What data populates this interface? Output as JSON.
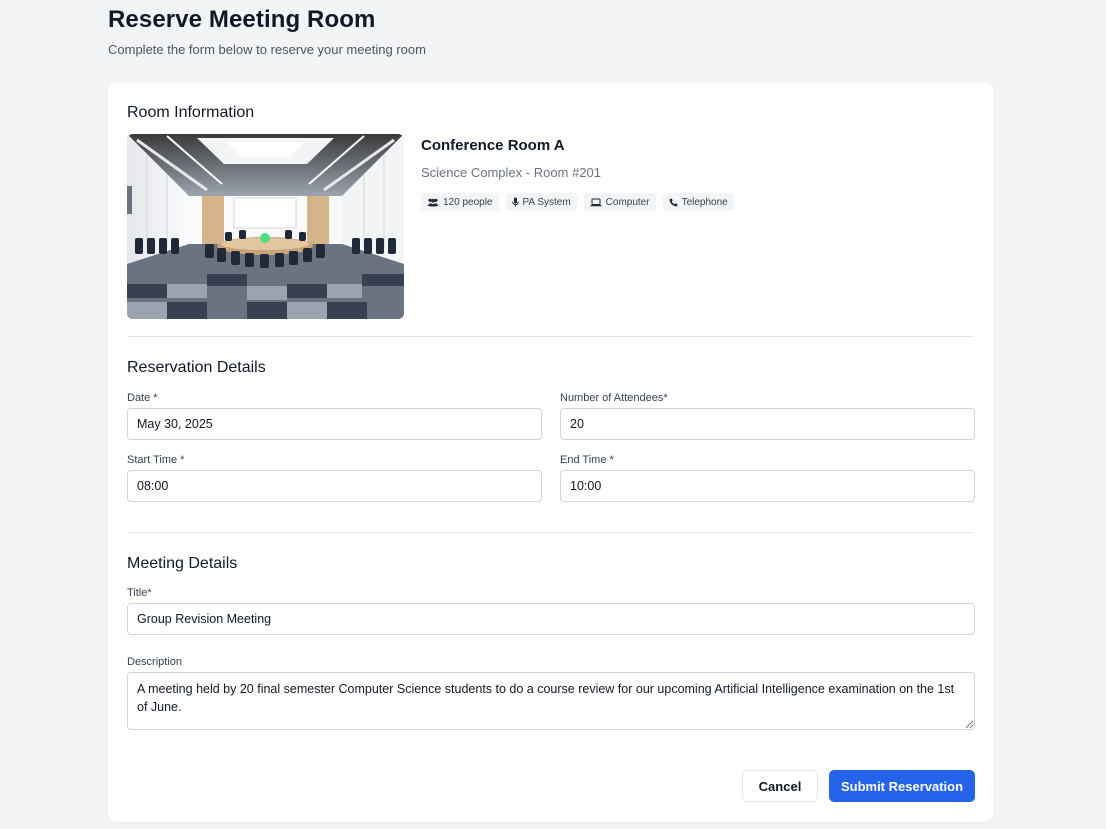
{
  "header": {
    "title": "Reserve Meeting Room",
    "subtitle": "Complete the form below to reserve your meeting room"
  },
  "room_info": {
    "section_title": "Room Information",
    "name": "Conference Room A",
    "location": "Science Complex - Room #201",
    "features": [
      {
        "icon": "people-icon",
        "label": "120 people"
      },
      {
        "icon": "microphone-icon",
        "label": "PA System"
      },
      {
        "icon": "laptop-icon",
        "label": "Computer"
      },
      {
        "icon": "phone-icon",
        "label": "Telephone"
      }
    ]
  },
  "reservation": {
    "section_title": "Reservation Details",
    "date_label": "Date *",
    "date_value": "May 30, 2025",
    "attendees_label": "Number of Attendees*",
    "attendees_value": "20",
    "start_label": "Start Time *",
    "start_value": "08:00",
    "end_label": "End Time *",
    "end_value": "10:00"
  },
  "meeting": {
    "section_title": "Meeting Details",
    "title_label": "Title*",
    "title_value": "Group Revision Meeting",
    "description_label": "Description",
    "description_value": "A meeting held by 20 final semester Computer Science students to do a course review for our upcoming Artificial Intelligence examination on the 1st of June."
  },
  "actions": {
    "cancel_label": "Cancel",
    "submit_label": "Submit Reservation"
  },
  "colors": {
    "primary": "#2563eb",
    "background": "#f3f4f6"
  }
}
